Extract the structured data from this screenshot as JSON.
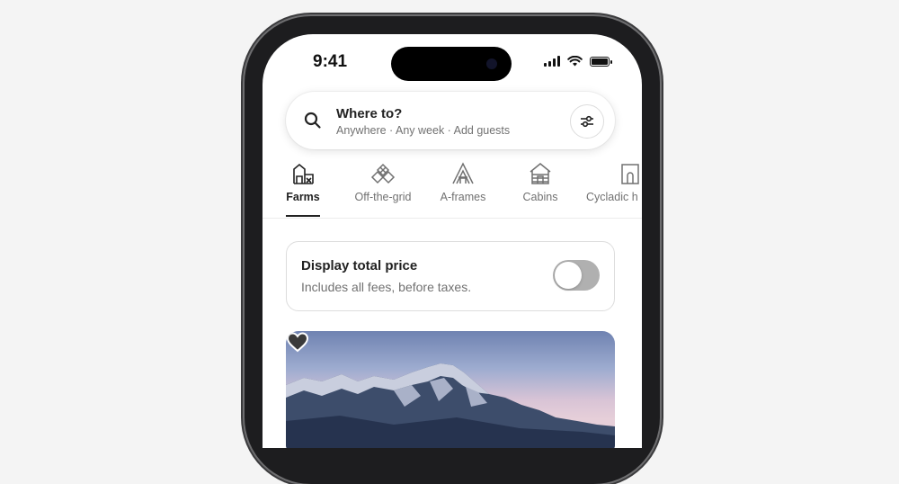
{
  "status_bar": {
    "time": "9:41"
  },
  "search": {
    "title": "Where to?",
    "subtitle": "Anywhere · Any week · Add guests"
  },
  "categories": [
    {
      "label": "Farms",
      "icon": "farm-icon",
      "active": true
    },
    {
      "label": "Off-the-grid",
      "icon": "off-the-grid-icon",
      "active": false
    },
    {
      "label": "A-frames",
      "icon": "a-frame-icon",
      "active": false
    },
    {
      "label": "Cabins",
      "icon": "cabin-icon",
      "active": false
    },
    {
      "label": "Cycladic h",
      "icon": "cycladic-home-icon",
      "active": false
    }
  ],
  "price_toggle": {
    "title": "Display total price",
    "subtitle": "Includes all fees, before taxes.",
    "enabled": false
  },
  "listing": {
    "favorited": true
  },
  "colors": {
    "text_primary": "#222222",
    "text_secondary": "#717171",
    "toggle_off": "#b0b0b0",
    "background": "#f4f4f4"
  }
}
